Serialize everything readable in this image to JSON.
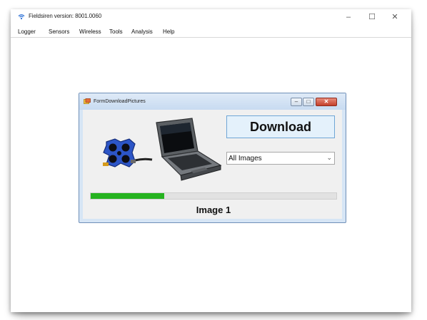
{
  "app": {
    "title": "Fieldsiren version: 8001.0060",
    "controls": {
      "minimize": "–",
      "maximize": "☐",
      "close": "✕"
    }
  },
  "menu": {
    "items": [
      {
        "label": "Logger"
      },
      {
        "label": "Sensors"
      },
      {
        "label": "Wireless"
      },
      {
        "label": "Tools"
      },
      {
        "label": "Analysis"
      },
      {
        "label": "Help"
      }
    ]
  },
  "dialog": {
    "title": "FormDownloadPictures",
    "download_label": "Download",
    "select": {
      "value": "All Images",
      "arrow": "⌄"
    },
    "progress": 0.3,
    "status": "Image 1",
    "controls": {
      "minimize": "–",
      "maximize": "□",
      "close": "✕"
    }
  },
  "icons": {
    "app": "wifi-icon",
    "dialog": "form-icon",
    "illustration": "device-laptop-illustration"
  },
  "colors": {
    "progress": "#25b31f",
    "download_button_bg": "#e4f1fb",
    "dialog_frame": "#d6e5f5"
  }
}
